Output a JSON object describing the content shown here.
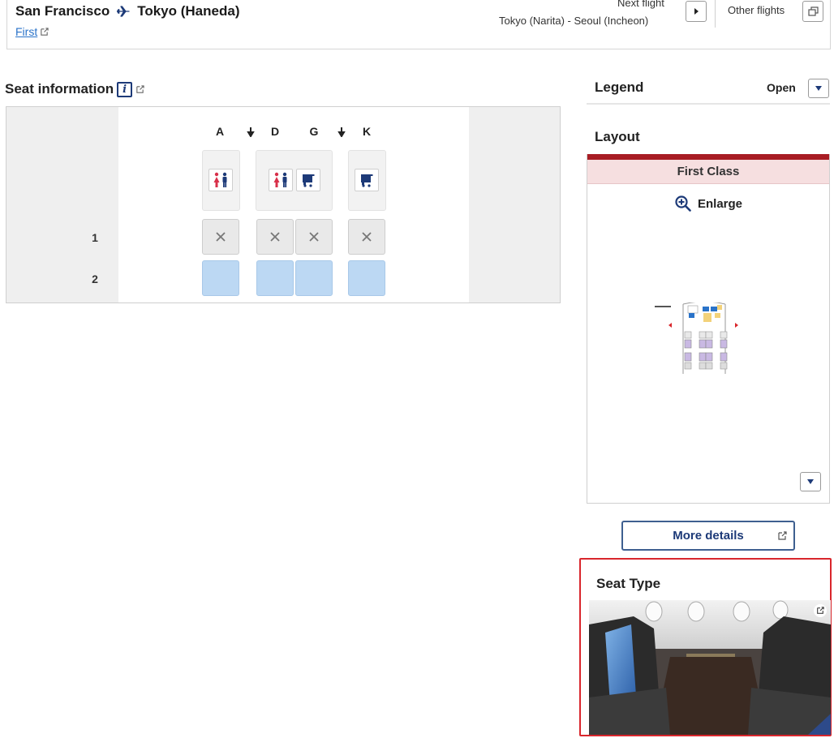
{
  "header": {
    "origin": "San Francisco",
    "destination": "Tokyo (Haneda)",
    "cabin_link": "First",
    "next_flight_label": "Next flight",
    "next_flight_route": "Tokyo (Narita) -  Seoul (Incheon)",
    "other_flights_label": "Other flights"
  },
  "seat_info": {
    "title": "Seat information",
    "info_icon_glyph": "i",
    "columns": [
      "A",
      "D",
      "G",
      "K"
    ],
    "rows": [
      "1",
      "2"
    ],
    "row_states": {
      "1": "unavailable",
      "2": "available"
    },
    "facilities": {
      "left": [
        "lavatory-icon"
      ],
      "center": [
        "lavatory-icon",
        "galley-icon"
      ],
      "right": [
        "galley-icon"
      ]
    }
  },
  "legend": {
    "title": "Legend",
    "toggle_label": "Open"
  },
  "layout": {
    "title": "Layout",
    "class_name": "First Class",
    "enlarge_label": "Enlarge"
  },
  "more_details_label": "More details",
  "seat_type": {
    "title": "Seat Type"
  },
  "colors": {
    "brand_navy": "#1d3a78",
    "accent_red": "#a81d24",
    "available_seat": "#bcd8f3",
    "unavailable_seat": "#e9e9e9",
    "highlight_border": "#d9262c"
  }
}
